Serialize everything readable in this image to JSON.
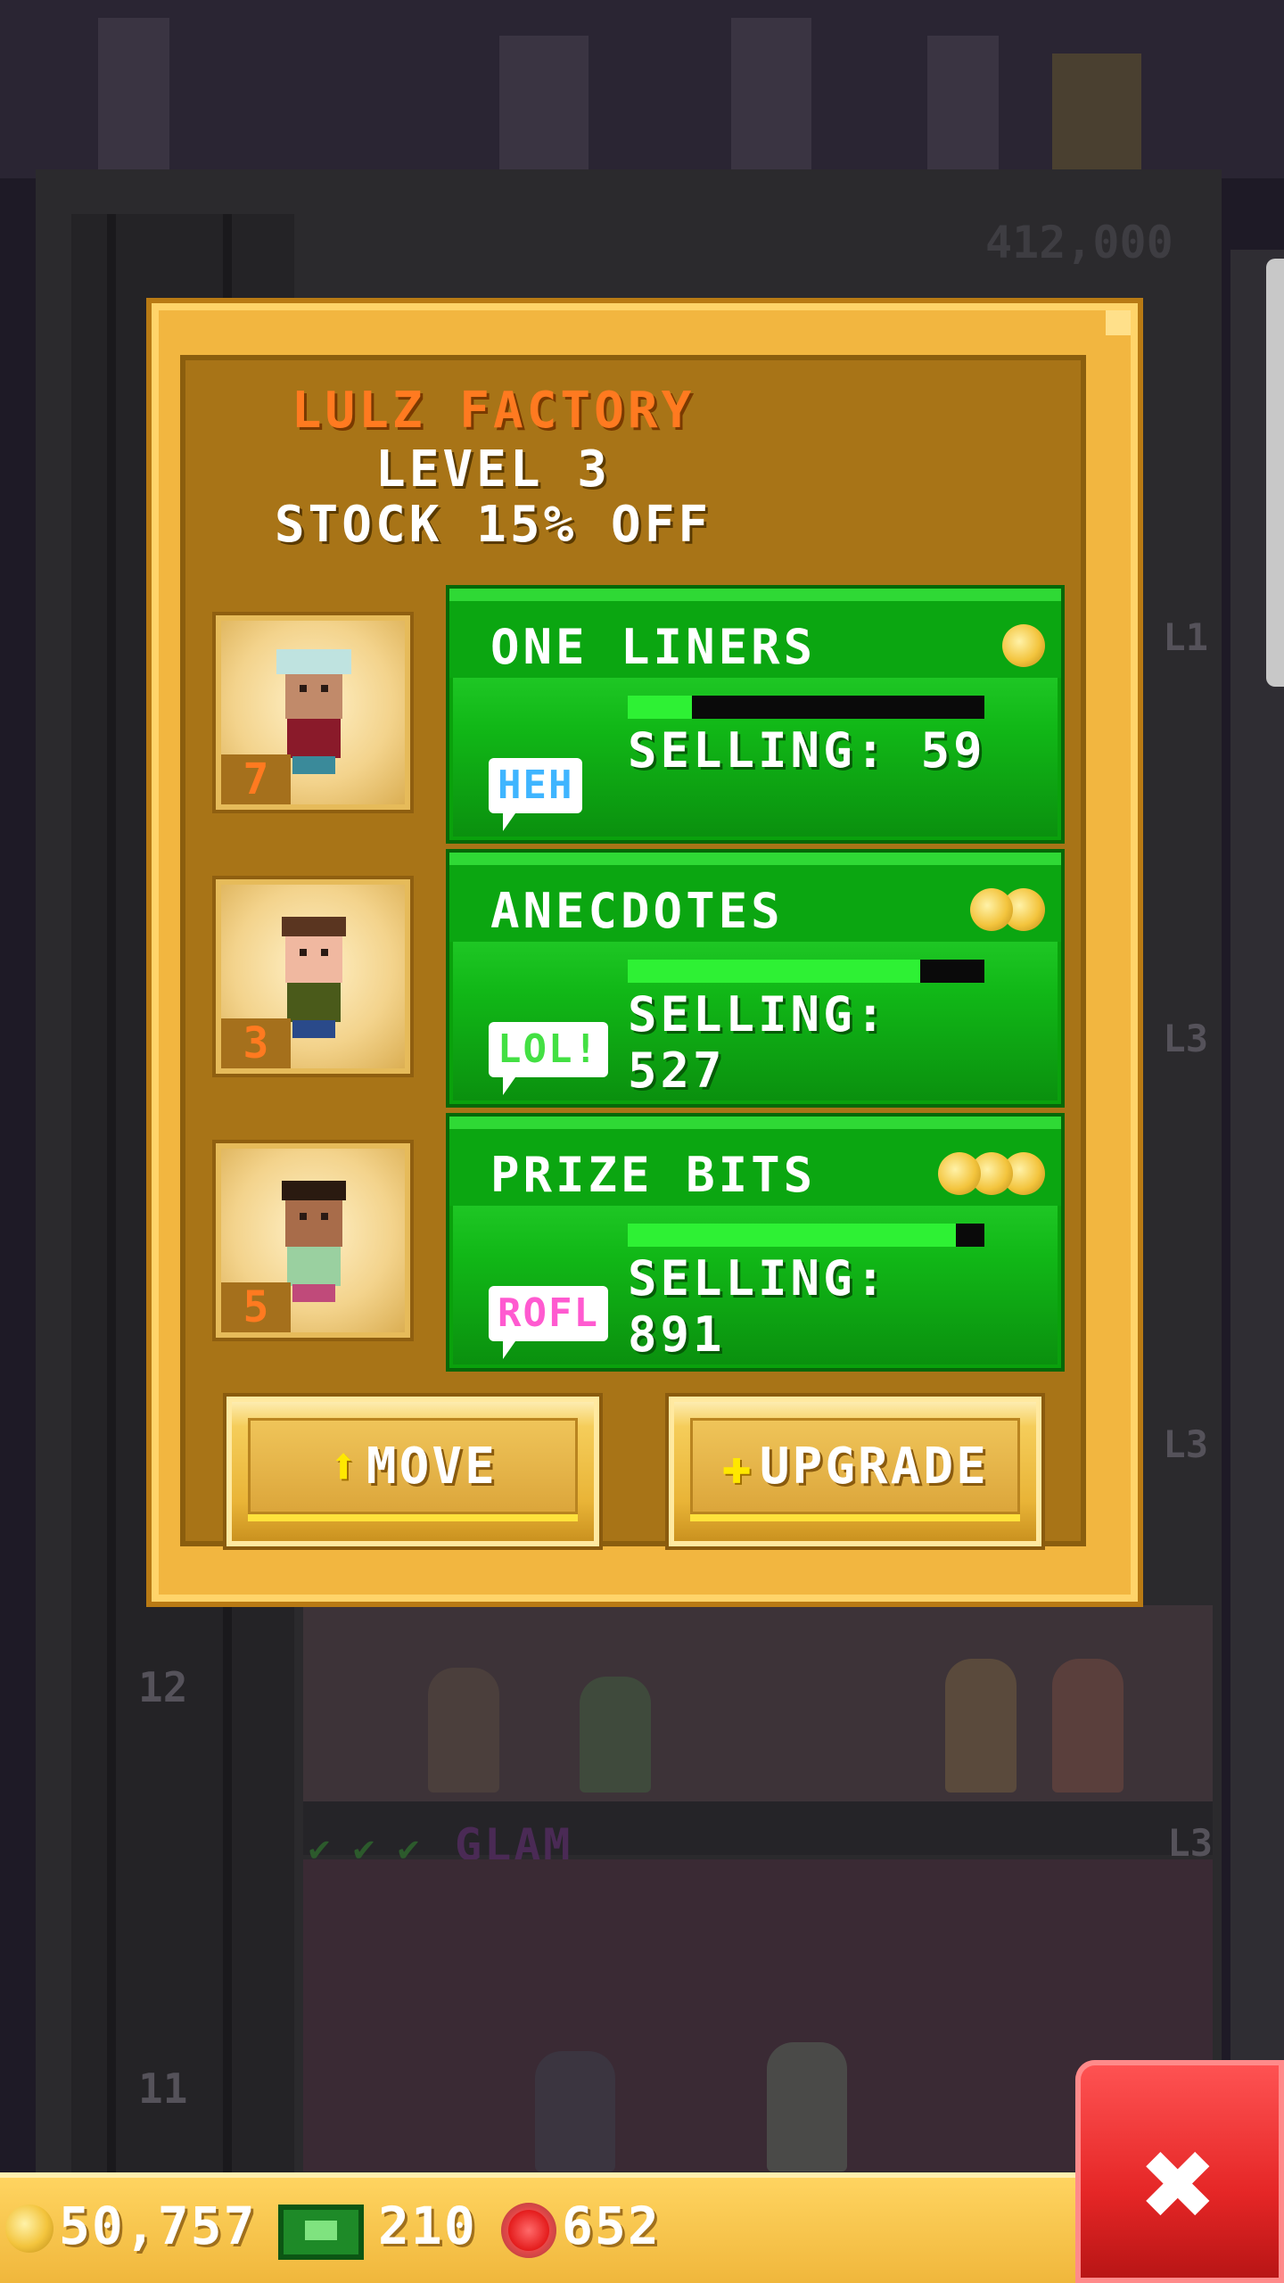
{
  "background": {
    "price_label": "412,000",
    "floors": [
      {
        "number": "12",
        "level": "L3"
      },
      {
        "number": "11",
        "level": "L3"
      }
    ],
    "side_levels": [
      "L1",
      "L3",
      "L3"
    ],
    "next_floor_name": "GLAM"
  },
  "popup": {
    "business_name": "LULZ FACTORY",
    "level_text": "LEVEL 3",
    "stock_text": "STOCK 15% OFF",
    "stocks": [
      {
        "name": "ONE LINERS",
        "coin_count": 1,
        "selling_text": "SELLING: 59",
        "stock_fraction": 0.18,
        "bubble_text": "HEH",
        "bubble_color": "#3fb5ff",
        "resident_stars": "7"
      },
      {
        "name": "ANECDOTES",
        "coin_count": 2,
        "selling_text": "SELLING: 527",
        "stock_fraction": 0.82,
        "bubble_text": "LOL!",
        "bubble_color": "#43e043",
        "resident_stars": "3"
      },
      {
        "name": "PRIZE BITS",
        "coin_count": 3,
        "selling_text": "SELLING: 891",
        "stock_fraction": 0.92,
        "bubble_text": "ROFL",
        "bubble_color": "#ff5ad0",
        "resident_stars": "5"
      }
    ],
    "move_label": "MOVE",
    "upgrade_label": "UPGRADE",
    "move_icon": "arrow-up-icon",
    "upgrade_icon": "plus-icon"
  },
  "hud": {
    "coins": "50,757",
    "bux": "210",
    "chips": "652",
    "close_icon": "close-icon"
  }
}
